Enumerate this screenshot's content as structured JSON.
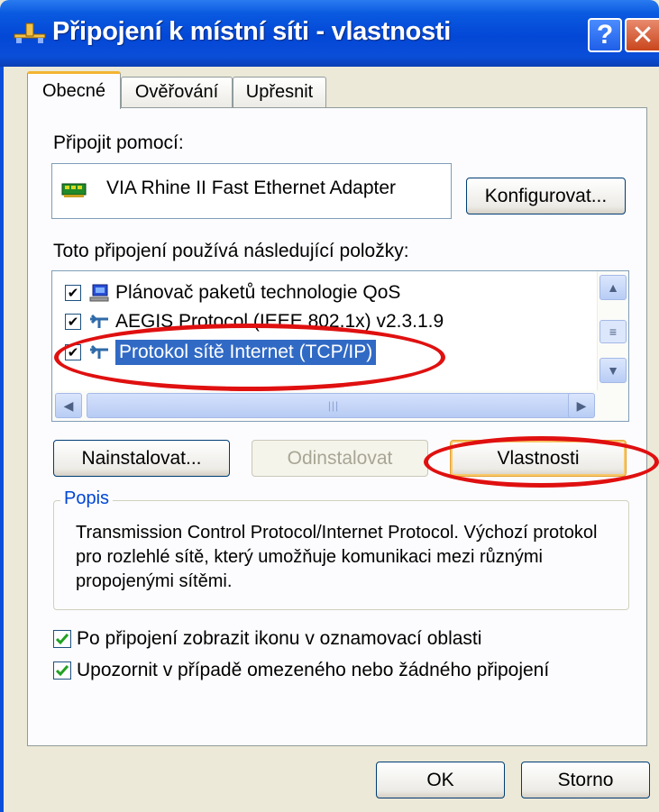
{
  "window": {
    "title": "Připojení k místní síti - vlastnosti",
    "help_glyph": "?",
    "close_glyph": "✕"
  },
  "tabs": [
    {
      "label": "Obecné",
      "active": true
    },
    {
      "label": "Ověřování",
      "active": false
    },
    {
      "label": "Upřesnit",
      "active": false
    }
  ],
  "connect_using": {
    "label": "Připojit pomocí:",
    "adapter": "VIA Rhine II Fast Ethernet Adapter",
    "configure_button": "Konfigurovat..."
  },
  "components": {
    "label": "Toto připojení používá následující položky:",
    "items": [
      {
        "label": "Plánovač paketů technologie QoS",
        "checked": true,
        "icon": "network-scheduler-icon"
      },
      {
        "label": "AEGIS Protocol (IEEE 802.1x) v2.3.1.9",
        "checked": true,
        "icon": "protocol-icon"
      },
      {
        "label": "Protokol sítě Internet (TCP/IP)",
        "checked": true,
        "selected": true,
        "icon": "protocol-icon"
      }
    ]
  },
  "actions": {
    "install": "Nainstalovat...",
    "uninstall": "Odinstalovat",
    "properties": "Vlastnosti"
  },
  "description": {
    "title": "Popis",
    "text": "Transmission Control Protocol/Internet Protocol. Výchozí protokol pro rozlehlé sítě, který umožňuje komunikaci mezi různými propojenými sítěmi."
  },
  "options": [
    {
      "label": "Po připojení zobrazit ikonu v oznamovací oblasti",
      "checked": true
    },
    {
      "label": "Upozornit v případě omezeného nebo žádného připojení",
      "checked": true
    }
  ],
  "footer": {
    "ok": "OK",
    "cancel": "Storno"
  },
  "colors": {
    "titlebar": "#0a4ed8",
    "selection": "#316ac5",
    "annotation_ring": "#e01010",
    "group_title": "#0046d5"
  }
}
